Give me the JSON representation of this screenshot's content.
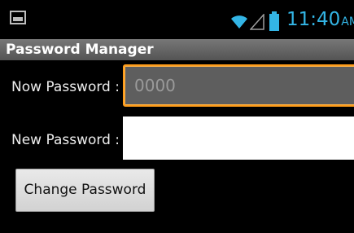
{
  "statusbar": {
    "time": "11:40",
    "ampm": "AM",
    "icons": [
      "image-notification-icon",
      "wifi-icon",
      "signal-icon",
      "battery-icon"
    ],
    "clock_color": "#33b5e5"
  },
  "app": {
    "title": "Password Manager"
  },
  "form": {
    "now_label": "Now Password :",
    "now_placeholder": "0000",
    "new_label": "New Password :",
    "new_value": "",
    "change_button": "Change Password"
  },
  "colors": {
    "focus_border": "#ff9d1b"
  }
}
